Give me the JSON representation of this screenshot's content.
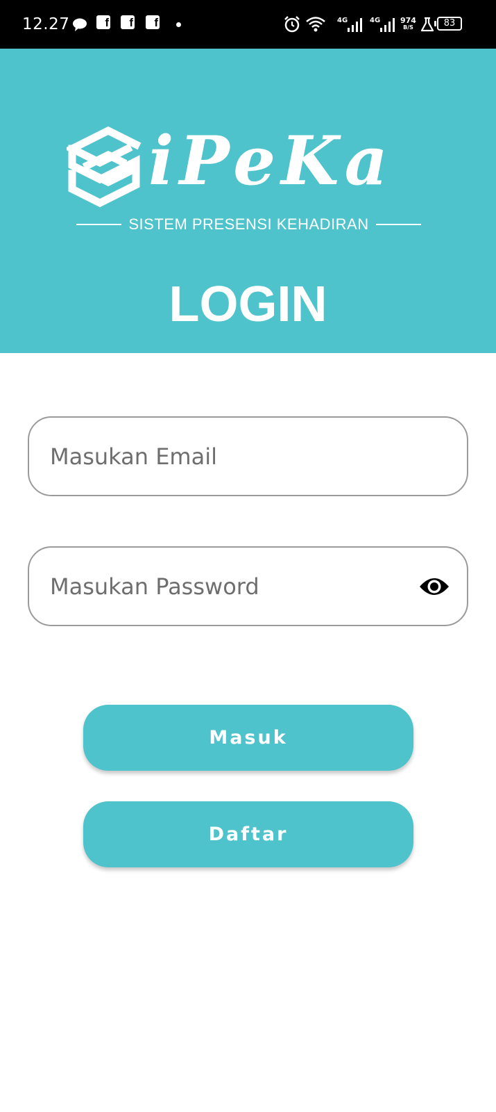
{
  "status_bar": {
    "time": "12.27",
    "network_1": "4G",
    "network_2": "4G",
    "speed_value": "974",
    "speed_unit": "B/S",
    "battery": "83"
  },
  "header": {
    "logo_text": "iPeKa",
    "tagline": "SISTEM PRESENSI KEHADIRAN",
    "title": "LOGIN",
    "background_color": "#4ec3cb"
  },
  "form": {
    "email_placeholder": "Masukan Email",
    "password_placeholder": "Masukan Password"
  },
  "buttons": {
    "masuk_label": "Masuk",
    "daftar_label": "Daftar",
    "color": "#4ec3cb"
  },
  "icons": {
    "status": [
      "chat-bubble-icon",
      "facebook-icon",
      "facebook-icon",
      "facebook-icon",
      "notification-dot-icon",
      "alarm-icon",
      "wifi-icon",
      "signal-icon",
      "signal-icon",
      "lab-flask-icon",
      "battery-icon"
    ],
    "logo": "stacked-layers-logo-icon",
    "password_toggle": "eye-icon"
  }
}
